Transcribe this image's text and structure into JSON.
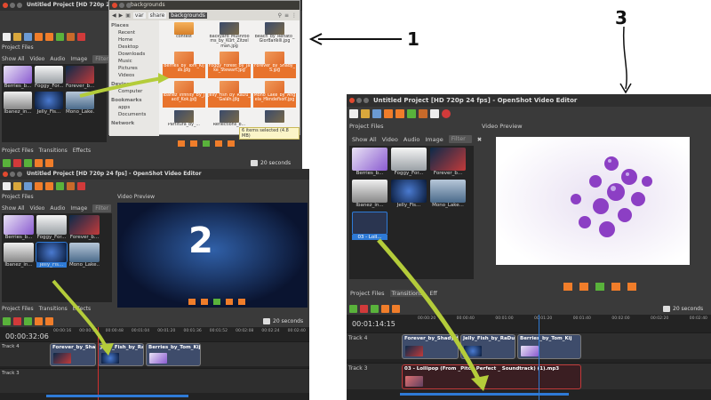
{
  "annotations": {
    "one": "1",
    "two": "2",
    "three": "3"
  },
  "colors": {
    "accent_orange": "#f07d2a",
    "timeline_blue": "#2e7ad6",
    "arrow_green": "#b4cc3a",
    "playhead_red": "#d03030"
  },
  "win1": {
    "title": "Untitled Project [HD 720p 24 fps] - OpenSh",
    "tabs_label": "Project Files",
    "tabs": [
      "Show All",
      "Video",
      "Audio",
      "Image"
    ],
    "filter_placeholder": "Filter",
    "thumbs": [
      "Berries_b...",
      "Foggy_For...",
      "Forever_b...",
      "Ibanez_in...",
      "Jelly_Fis...",
      "Mono_Lake..."
    ],
    "bottom_tabs": [
      "Project Files",
      "Transitions",
      "Effects"
    ],
    "seconds": "20 seconds"
  },
  "filemanager": {
    "title": "backgrounds",
    "path": [
      "var",
      "share",
      "backgrounds"
    ],
    "places_label": "Places",
    "places": [
      "Recent",
      "Home",
      "Desktop",
      "Downloads",
      "Music",
      "Pictures",
      "Videos"
    ],
    "devices_label": "Devices",
    "devices": [
      "Computer"
    ],
    "bookmarks_label": "Bookmarks",
    "bookmarks": [
      "apps",
      "Documents"
    ],
    "network_label": "Network",
    "files": [
      {
        "name": "contest",
        "type": "folder"
      },
      {
        "name": "Backyard_Mushrooms_by_Kurt_Zitzelman.jpg",
        "type": "img"
      },
      {
        "name": "Beach_by_Renato_Giordanelli.jpg",
        "type": "img"
      },
      {
        "name": "Berries_by_Tom_Kijas.jpg",
        "type": "sel"
      },
      {
        "name": "Foggy_Forest_by_Jake_Stewart.jpg",
        "type": "sel"
      },
      {
        "name": "Forever_by_Shady_S.jpg",
        "type": "sel"
      },
      {
        "name": "Ibanez_Infinity_by_Jaco_Kok.jpg",
        "type": "sel"
      },
      {
        "name": "Jelly_Fish_by_RaDu_Galan.jpg",
        "type": "sel"
      },
      {
        "name": "Mono_Lake_by_Angela_Henderson.jpg",
        "type": "sel"
      },
      {
        "name": "Partitura_by_...",
        "type": "img"
      },
      {
        "name": "Reflections_b...",
        "type": "img"
      },
      {
        "name": "",
        "type": "img"
      }
    ],
    "status": "6 items selected (4.8 MB)"
  },
  "win2": {
    "title": "Untitled Project [HD 720p 24 fps] - OpenShot Video Editor",
    "tabs_label": "Project Files",
    "tabs": [
      "Show All",
      "Video",
      "Audio",
      "Image"
    ],
    "filter_placeholder": "Filter",
    "thumbs": [
      "Berries_b...",
      "Foggy_For...",
      "Forever_b...",
      "Ibanez_in...",
      "Jelly_Fis...",
      "Mono_Lake..."
    ],
    "preview_label": "Video Preview",
    "bottom_tabs": [
      "Project Files",
      "Transitions",
      "Effects"
    ],
    "seconds": "20 seconds",
    "timecode": "00:00:32:06",
    "ruler": [
      "00:00:16",
      "00:00:32",
      "00:00:48",
      "00:01:04",
      "00:01:20",
      "00:01:36",
      "00:01:52",
      "00:02:08",
      "00:02:24",
      "00:02:40"
    ],
    "track4_label": "Track 4",
    "track3_label": "Track 3",
    "clips": [
      "Forever_by_Shady_S",
      "Jelly_Fish_by_RaDu G",
      "Berries_by_Tom_Kijas"
    ]
  },
  "win3": {
    "title": "Untitled Project [HD 720p 24 fps] - OpenShot Video Editor",
    "tabs_label": "Project Files",
    "tabs": [
      "Show All",
      "Video",
      "Audio",
      "Image"
    ],
    "filter_placeholder": "Filter",
    "thumbs": [
      "Berries_b...",
      "Foggy_For...",
      "Forever_b...",
      "Ibanez_in...",
      "Jelly_Fis...",
      "Mono_Lake...",
      "03 - Loll..."
    ],
    "preview_label": "Video Preview",
    "bottom_tabs": [
      "Project Files",
      "Transitions",
      "Eff"
    ],
    "seconds": "20 seconds",
    "timecode": "00:01:14:15",
    "ruler": [
      "00:00:20",
      "00:00:40",
      "00:01:00",
      "00:01:20",
      "00:01:40",
      "00:02:00",
      "00:02:20",
      "00:02:40"
    ],
    "track4_label": "Track 4",
    "track3_label": "Track 3",
    "clips": [
      "Forever_by_Shady_S",
      "Jelly_Fish_by_RaDu G",
      "Berries_by_Tom_Kij"
    ],
    "audio_clip": "03 - Lollipop (From _Pitch Perfect _ Soundtrack) (1).mp3"
  }
}
